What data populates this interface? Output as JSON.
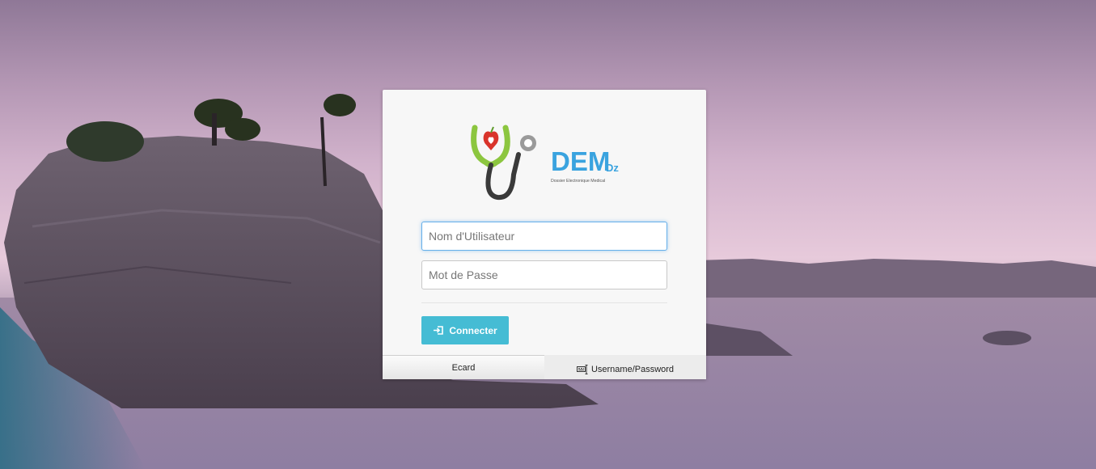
{
  "login": {
    "username_placeholder": "Nom d'Utilisateur",
    "password_placeholder": "Mot de Passe",
    "submit_label": "Connecter"
  },
  "logo": {
    "brand": "DEM",
    "suffix": "Dz",
    "tagline": "Dossier Electronique Medical"
  },
  "tabs": [
    {
      "label": "Ecard",
      "icon": ""
    },
    {
      "label": "Username/Password",
      "icon": "keyboard-icon"
    }
  ],
  "colors": {
    "button": "#45bcd4",
    "brand": "#3aa3df",
    "stethoscope_green": "#8cc63f",
    "focus_border": "#66afe9"
  }
}
